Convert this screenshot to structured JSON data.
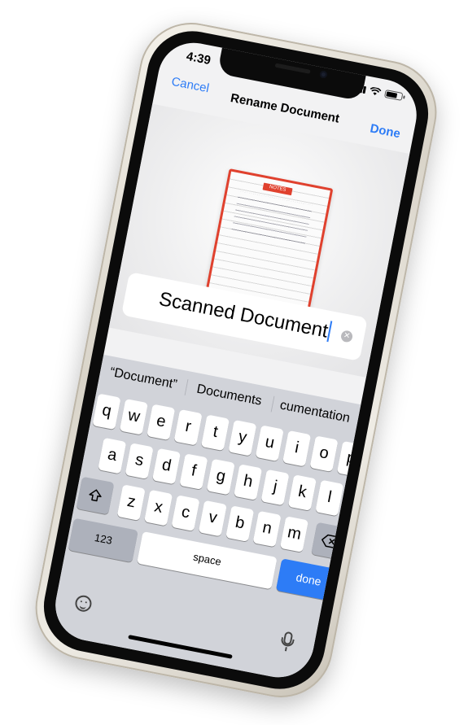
{
  "status_bar": {
    "time": "4:39"
  },
  "navbar": {
    "cancel": "Cancel",
    "title": "Rename Document",
    "done": "Done"
  },
  "document_preview": {
    "tab_label": "NOTES"
  },
  "name_field": {
    "value": "Scanned Document"
  },
  "suggestions": [
    "“Document”",
    "Documents",
    "cumentation"
  ],
  "keyboard": {
    "row1": [
      "q",
      "w",
      "e",
      "r",
      "t",
      "y",
      "u",
      "i",
      "o",
      "p"
    ],
    "row2": [
      "a",
      "s",
      "d",
      "f",
      "g",
      "h",
      "j",
      "k",
      "l"
    ],
    "row3": [
      "z",
      "x",
      "c",
      "v",
      "b",
      "n",
      "m"
    ],
    "numbers_label": "123",
    "space_label": "space",
    "done_label": "done"
  },
  "colors": {
    "accent": "#2d7cf6",
    "document_border": "#e0412e"
  },
  "icons": [
    "shift-icon",
    "backspace-icon",
    "emoji-icon",
    "microphone-icon",
    "clear-icon"
  ]
}
